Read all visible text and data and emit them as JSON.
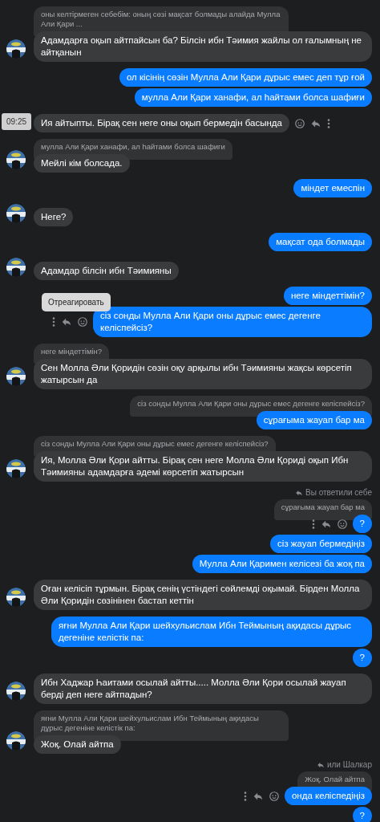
{
  "messages": [
    {
      "kind": "in",
      "avatar": true,
      "quote": "оны келтірмеген себебім: оның сөзі мақсат болмады алайда Мулла Али Қари ...",
      "text": "Адамдарға оқып айтпайсын ба? Білсін ибн Тәимия жайлы ол ғалымның не айтқанын"
    },
    {
      "kind": "out",
      "text": "ол кісінің сөзін Мулла Али Қари дұрыс емес деп тұр ғой"
    },
    {
      "kind": "out",
      "text": "мулла Али Қари ханафи, ал һайтами болса шафиғи"
    },
    {
      "kind": "in",
      "avatar": false,
      "time": "09:25",
      "actions": true,
      "text": "Ия айтыпты. Бірақ сен неге оны оқып бермедін басында"
    },
    {
      "kind": "in",
      "avatar": true,
      "quote": "мулла Али Қари ханафи, ал һайтами болса шафиги",
      "text": "Мейлі кім болсада."
    },
    {
      "kind": "out",
      "text": "міндет емеспін"
    },
    {
      "kind": "in",
      "avatar": true,
      "text": "Неге?"
    },
    {
      "kind": "out",
      "text": "мақсат ода болмады"
    },
    {
      "kind": "in",
      "avatar": true,
      "text": "Адамдар білсін ибн Тәимияны"
    },
    {
      "kind": "out",
      "text": "неге міндеттімін?"
    },
    {
      "kind": "out",
      "actions": true,
      "tooltip": "Отреагировать",
      "text": "сіз сонды Мулла Али Қари оны дұрыс емес дегенге келіспейсіз?"
    },
    {
      "kind": "in",
      "avatar": true,
      "quote": "неге міндеттімін?",
      "text": "Сен Молла Әли Қоридін сөзін оқу арқылы ибн Тәимияны жақсы көрсетіп жатырсын да"
    },
    {
      "kind": "out",
      "quote": "сіз сонды Мулла Али Қари оны дұрыс емес дегенге келіспейсіз?",
      "text": "сұрағыма жауап бар ма"
    },
    {
      "kind": "in",
      "avatar": true,
      "quote": "сіз сонды Мулла Али Қари оны дұрыс емес дегенге келіспейсіз?",
      "text": "Ия, Молла Әли Қори айтты. Бірақ сен неге Молла Әли Қориді оқып Ибн Тәимияны адамдарға әдемі көрсетіп жатырсын"
    },
    {
      "kind": "out",
      "note": "Вы ответили себе",
      "quote": "сұрағыма жауап бар ма",
      "actions": true,
      "text": "?"
    },
    {
      "kind": "out",
      "text": "сіз жауап бермедіңіз"
    },
    {
      "kind": "out",
      "text": "Мулла Али Қаримен келісезі ба жоқ па"
    },
    {
      "kind": "in",
      "avatar": true,
      "text": "Оған келісіп тұрмын. Бірақ сенің үстіндегі сөйлемді оқымай. Бірден Молла Әли Қоридін сөзінінен бастап кеттін"
    },
    {
      "kind": "out",
      "text": "яғни Мулла Али Қари шейхульислам Ибн Теймының ақидасы дұрыс дегеніне келістік па:"
    },
    {
      "kind": "out",
      "text": "?"
    },
    {
      "kind": "in",
      "avatar": true,
      "text": "Ибн Хаджар Һаитами осылай айтты..... Молла Әли Қори осылай жауап берді деп неге айтпадын?"
    },
    {
      "kind": "in",
      "avatar": true,
      "quote": "яғни Мулла Али Қари шейхульислам Ибн Теймының ақидасы дұрыс дегеніне келістік па:",
      "text": "Жоқ. Олай айтпа"
    },
    {
      "kind": "out",
      "note": "или Шалкар",
      "quote": "Жоқ. Олай айтпа",
      "actions": true,
      "text": "онда келіспедіңіз"
    },
    {
      "kind": "out",
      "text": "?"
    }
  ]
}
